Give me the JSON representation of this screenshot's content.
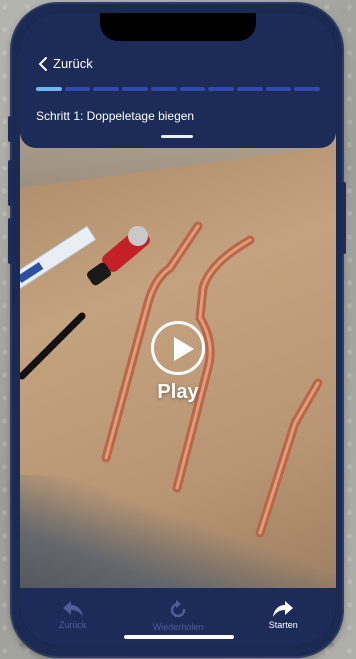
{
  "header": {
    "back_label": "Zurück",
    "step_title": "Schritt 1: Doppeletage biegen",
    "progress": {
      "total_segments": 10,
      "completed": 1
    }
  },
  "video": {
    "play_label": "Play"
  },
  "bottom_bar": {
    "back": {
      "label": "Zurück",
      "icon": "reply-arrow-icon"
    },
    "repeat": {
      "label": "Wiederholen",
      "icon": "refresh-icon"
    },
    "start": {
      "label": "Starten",
      "icon": "share-arrow-icon"
    }
  },
  "colors": {
    "bar_bg": "#1c2b57",
    "progress_done": "#6fb6f2",
    "progress_todo": "#2f4aa8",
    "tab_disabled": "#4c5e96"
  }
}
